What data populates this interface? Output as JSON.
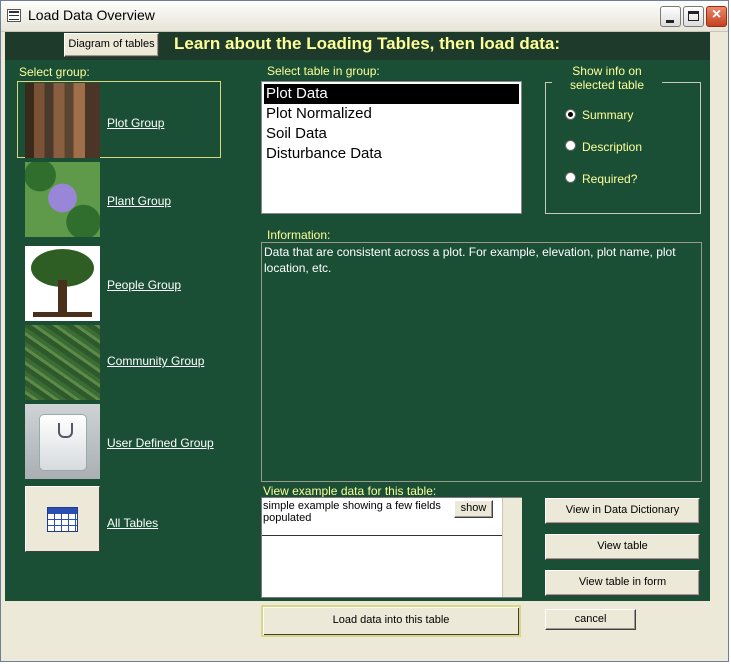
{
  "window": {
    "title": "Load Data Overview"
  },
  "header": {
    "diagram_button": "Diagram of tables",
    "title": "Learn about the Loading Tables, then load data:"
  },
  "groups": {
    "label": "Select group:",
    "selected_index": 0,
    "items": [
      {
        "label": "Plot Group",
        "icon": "forest-image"
      },
      {
        "label": "Plant Group",
        "icon": "periwinkle-flower-image"
      },
      {
        "label": "People Group",
        "icon": "person-tree-image"
      },
      {
        "label": "Community Group",
        "icon": "fern-image"
      },
      {
        "label": "User Defined Group",
        "icon": "keyboard-key-image"
      },
      {
        "label": "All Tables",
        "icon": "table-icon"
      }
    ]
  },
  "tables": {
    "label": "Select table in group:",
    "selected_index": 0,
    "items": [
      "Plot Data",
      "Plot Normalized",
      "Soil Data",
      "Disturbance Data"
    ]
  },
  "info_options": {
    "label": "Show info on selected table",
    "selected": "Summary",
    "options": [
      "Summary",
      "Description",
      "Required?"
    ]
  },
  "information": {
    "label": "Information:",
    "text": "Data that are consistent across a plot.  For example, elevation, plot name, plot location, etc."
  },
  "example": {
    "label": "View example data for this table:",
    "row_text": "simple example showing a few fields populated",
    "show_button": "show"
  },
  "actions": {
    "view_dictionary": "View in Data Dictionary",
    "view_table": "View table",
    "view_table_form": "View table in form",
    "load_data": "Load data into this table",
    "cancel": "cancel"
  },
  "colors": {
    "panel_background": "#1a4f36",
    "header_background": "#1d3a2a",
    "label_text": "#ffff99",
    "selection": "#000000"
  }
}
